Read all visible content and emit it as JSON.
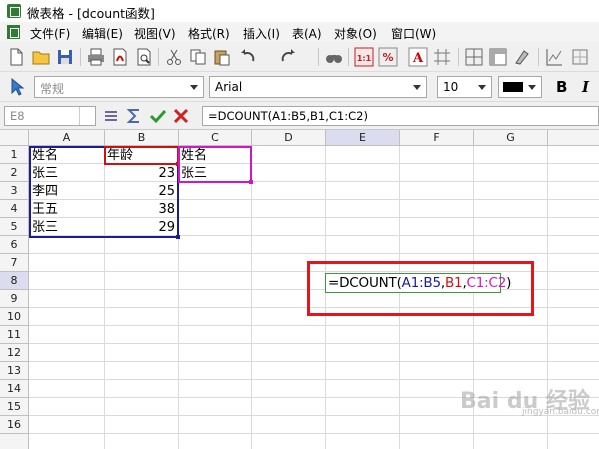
{
  "window": {
    "title": "微表格 - [dcount函数]"
  },
  "menu": [
    "文件(F)",
    "编辑(E)",
    "视图(V)",
    "格式(R)",
    "插入(I)",
    "表(A)",
    "对象(O)",
    "窗口(W)"
  ],
  "toolbar1": {
    "icons": [
      "new-file-icon",
      "open-folder-icon",
      "save-icon",
      "print-icon",
      "pdf-export-icon",
      "print-preview-icon",
      "cut-icon",
      "copy-icon",
      "paste-icon",
      "undo-icon",
      "redo-icon",
      "find-icon",
      "zoom-1to1-icon",
      "percent-icon",
      "text-color-icon",
      "grid-icon",
      "borders-icon",
      "freeze-icon",
      "clear-format-icon",
      "chart-icon",
      "more-icon"
    ]
  },
  "toolbar2": {
    "style_value": "常规",
    "font_value": "Arial",
    "size_value": "10",
    "bold_label": "B",
    "italic_label": "I"
  },
  "formula_bar": {
    "name_box": "E8",
    "formula": "=DCOUNT(A1:B5,B1,C1:C2)"
  },
  "sheet": {
    "columns": [
      "A",
      "B",
      "C",
      "D",
      "E",
      "F",
      "G"
    ],
    "active_column": "E",
    "rows": [
      "1",
      "2",
      "3",
      "4",
      "5",
      "6",
      "7",
      "8",
      "9",
      "10",
      "11",
      "12",
      "13",
      "14",
      "15",
      "16"
    ],
    "active_row": "8",
    "cells": {
      "A1": "姓名",
      "B1": "年龄",
      "C1": "姓名",
      "A2": "张三",
      "B2": "23",
      "C2": "张三",
      "A3": "李四",
      "B3": "25",
      "A4": "王五",
      "B4": "38",
      "A5": "张三",
      "B5": "29"
    },
    "editing_formula": {
      "prefix": "=DCOUNT(",
      "ref1": "A1:B5",
      "sep1": ",",
      "ref2": "B1",
      "sep2": ",",
      "ref3": "C1:C2",
      "suffix": ")"
    }
  },
  "colors": {
    "range_a1b5": "#1c1c9a",
    "range_b1": "#d01010",
    "range_c1c2": "#d016c8",
    "highlight": "#e8141b",
    "edit_border": "#3a9a3a"
  },
  "watermark": {
    "text": "Bai du 经验",
    "sub": "jingyan.baidu.com"
  }
}
